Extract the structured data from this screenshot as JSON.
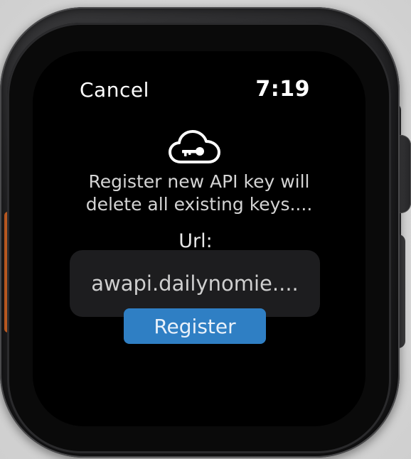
{
  "header": {
    "cancel_label": "Cancel",
    "time": "7:19"
  },
  "icon": {
    "name": "cloud-key-icon"
  },
  "message": {
    "line1": "Register new API key will",
    "line2": "delete all existing keys...."
  },
  "form": {
    "url_label": "Url:",
    "url_value": "awapi.dailynomie...."
  },
  "actions": {
    "register_label": "Register"
  },
  "colors": {
    "accent": "#2f7fc4",
    "action_button": "#c7601f",
    "screen_bg": "#000000",
    "field_bg": "#1d1d1f"
  }
}
